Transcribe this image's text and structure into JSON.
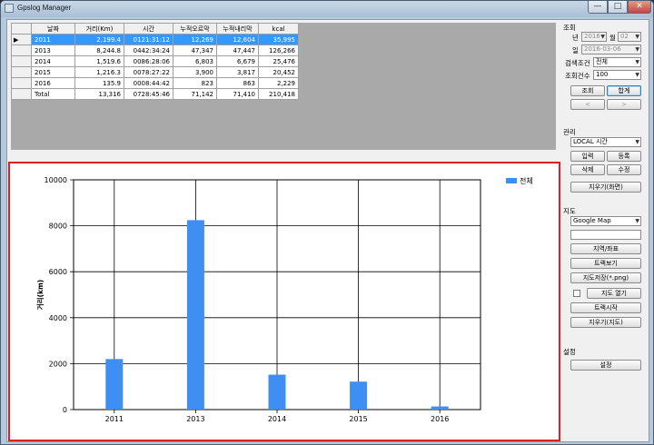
{
  "window": {
    "title": "Gpslog Manager",
    "min": "—",
    "max": "□",
    "close": "✕"
  },
  "grid": {
    "columns": [
      "날짜",
      "거리(Km)",
      "시간",
      "누적오르막",
      "누적내리막",
      "kcal"
    ],
    "rows": [
      {
        "marker": "▶",
        "date": "2011",
        "distance": "2,199.4",
        "time": "0121:31:12",
        "ascent": "12,269",
        "descent": "12,604",
        "kcal": "35,995"
      },
      {
        "marker": "",
        "date": "2013",
        "distance": "8,244.8",
        "time": "0442:34:24",
        "ascent": "47,347",
        "descent": "47,447",
        "kcal": "126,266"
      },
      {
        "marker": "",
        "date": "2014",
        "distance": "1,519.6",
        "time": "0086:28:06",
        "ascent": "6,803",
        "descent": "6,679",
        "kcal": "25,476"
      },
      {
        "marker": "",
        "date": "2015",
        "distance": "1,216.3",
        "time": "0078:27:22",
        "ascent": "3,900",
        "descent": "3,817",
        "kcal": "20,452"
      },
      {
        "marker": "",
        "date": "2016",
        "distance": "135.9",
        "time": "0008:44:42",
        "ascent": "823",
        "descent": "863",
        "kcal": "2,229"
      },
      {
        "marker": "",
        "date": "Total",
        "distance": "13,316",
        "time": "0728:45:46",
        "ascent": "71,142",
        "descent": "71,410",
        "kcal": "210,418"
      }
    ]
  },
  "chart_data": {
    "type": "bar",
    "categories": [
      "2011",
      "2013",
      "2014",
      "2015",
      "2016"
    ],
    "series": [
      {
        "name": "전체",
        "values": [
          2199.4,
          8244.8,
          1519.6,
          1216.3,
          135.9
        ],
        "color": "#3f8ef2"
      }
    ],
    "ylabel": "거리(km)",
    "xlabel": "",
    "ylim": [
      0,
      10000
    ],
    "yticks": [
      "0",
      "2000",
      "4000",
      "6000",
      "8000",
      "10000"
    ],
    "grid": true,
    "legend": "top-right"
  },
  "side": {
    "query": {
      "title": "조회",
      "year_label": "년",
      "year_value": "2016",
      "month_label": "월",
      "month_value": "02",
      "date_label": "일",
      "date_value": "2016-03-06",
      "cond_label": "검색조건",
      "cond_value": "전체",
      "count_label": "조회건수",
      "count_value": "100",
      "search_button": "조회",
      "sum_button": "합계",
      "prev_button": "<",
      "next_button": ">"
    },
    "manage": {
      "title": "관리",
      "tz_value": "LOCAL 시간",
      "input_button": "입력",
      "register_button": "등록",
      "delete_button": "삭제",
      "edit_button": "수정",
      "clear_button": "지우기(화면)"
    },
    "map": {
      "title": "지도",
      "provider_value": "Google Map",
      "search_value": "",
      "region_button": "지역/좌표",
      "track_button": "트랙보기",
      "save_button": "지도저장(*.png)",
      "open_button": "지도 열기",
      "track_start_button": "트랙시작",
      "clear_map_button": "지우기(지도)"
    },
    "settings": {
      "title": "설정",
      "settings_button": "설정"
    }
  }
}
